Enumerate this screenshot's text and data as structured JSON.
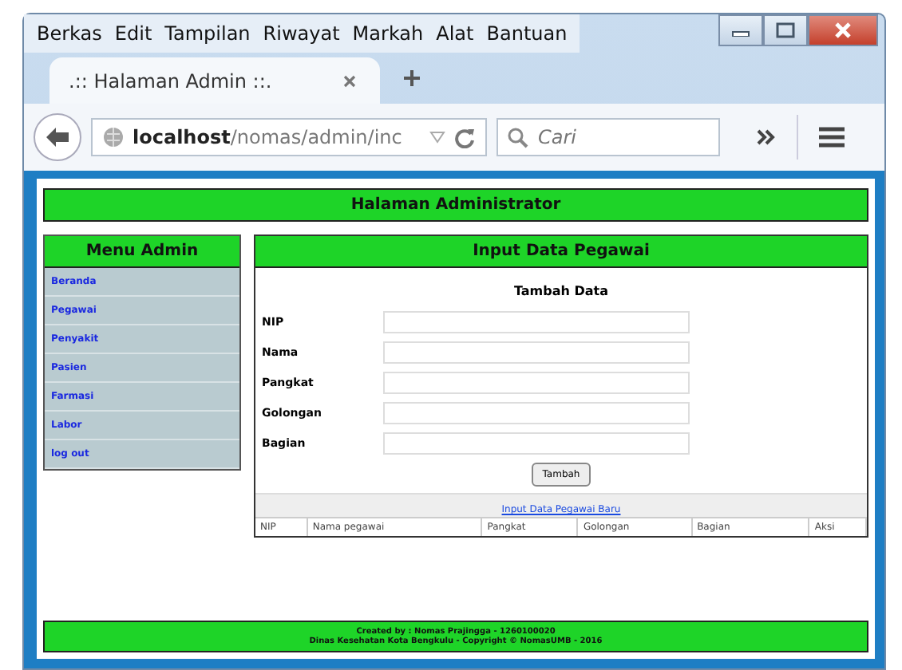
{
  "menu_bar": [
    "Berkas",
    "Edit",
    "Tampilan",
    "Riwayat",
    "Markah",
    "Alat",
    "Bantuan"
  ],
  "tabs": [
    {
      "label": ".:: Halaman Admin ::.",
      "selected": true
    }
  ],
  "address_bar": {
    "host": "localhost",
    "path": "/nomas/admin/inc"
  },
  "search": {
    "placeholder": "Cari"
  },
  "page": {
    "header": "Halaman Administrator",
    "sidebar": {
      "title": "Menu Admin",
      "items": [
        "Beranda",
        "Pegawai",
        "Penyakit",
        "Pasien",
        "Farmasi",
        "Labor",
        "log out"
      ]
    },
    "panel": {
      "title": "Input Data Pegawai",
      "form_title": "Tambah Data",
      "fields": [
        {
          "label": "NIP"
        },
        {
          "label": "Nama"
        },
        {
          "label": "Pangkat"
        },
        {
          "label": "Golongan"
        },
        {
          "label": "Bagian"
        }
      ],
      "submit": "Tambah",
      "table_caption": "Input Data Pegawai Baru",
      "table": {
        "columns": [
          "NIP",
          "Nama pegawai",
          "Pangkat",
          "Golongan",
          "Bagian",
          "Aksi"
        ]
      }
    },
    "footer": [
      "Created by : Nomas Prajingga - 1260100020",
      "Dinas Kesehatan Kota Bengkulu - Copyright © NomasUMB - 2016"
    ]
  }
}
